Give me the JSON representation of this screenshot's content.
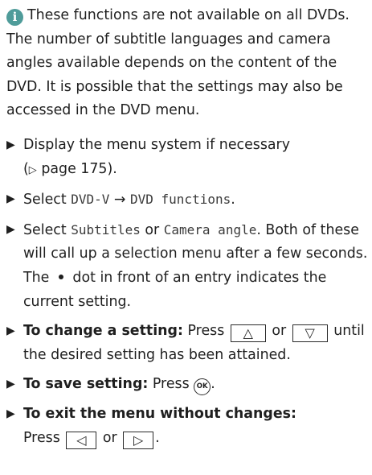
{
  "note": {
    "icon": "info-icon",
    "icon_glyph": "i",
    "text": "These functions are not available on all DVDs. The number of subtitle languages and camera angles available depends on the content of the DVD. It is possible that the settings may also be accessed in the DVD menu."
  },
  "steps": {
    "bullet": "▶",
    "s1": {
      "text": "Display the menu system if necessary",
      "ref_open": "(",
      "ref_symbol": "▷",
      "ref_text": "page 175",
      "ref_close": ")."
    },
    "s2": {
      "prefix": "Select",
      "code1": "DVD-V",
      "arrow": "→",
      "code2": "DVD functions",
      "suffix": "."
    },
    "s3": {
      "prefix": "Select",
      "code1": "Subtitles",
      "or": "or",
      "code2": "Camera angle",
      "suffix": ".",
      "text_a": "Both of these will call up a selection menu after a few seconds. The",
      "text_b": "dot in front of an entry indicates the current setting."
    },
    "s4": {
      "bold": "To change a setting:",
      "press": "Press",
      "key1": "△",
      "or": "or",
      "key2": "▽",
      "rest": "until the desired setting has been attained."
    },
    "s5": {
      "bold": "To save setting:",
      "press": "Press",
      "ok": "OK",
      "suffix": "."
    },
    "s6": {
      "bold": "To exit the menu without changes:",
      "press": "Press",
      "key1": "◁",
      "or": "or",
      "key2": "▷",
      "suffix": "."
    }
  }
}
